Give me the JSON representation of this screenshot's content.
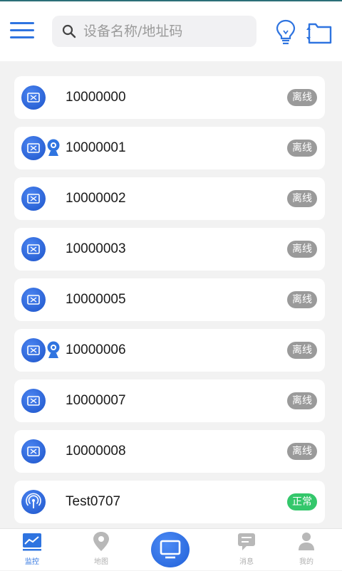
{
  "search": {
    "placeholder": "设备名称/地址码"
  },
  "devices": [
    {
      "id": "10000000",
      "status": "离线",
      "state": "offline",
      "icon": "tv-icon",
      "camera": false
    },
    {
      "id": "10000001",
      "status": "离线",
      "state": "offline",
      "icon": "tv-icon",
      "camera": true
    },
    {
      "id": "10000002",
      "status": "离线",
      "state": "offline",
      "icon": "tv-icon",
      "camera": false
    },
    {
      "id": "10000003",
      "status": "离线",
      "state": "offline",
      "icon": "tv-icon",
      "camera": false
    },
    {
      "id": "10000005",
      "status": "离线",
      "state": "offline",
      "icon": "tv-icon",
      "camera": false
    },
    {
      "id": "10000006",
      "status": "离线",
      "state": "offline",
      "icon": "tv-icon",
      "camera": true
    },
    {
      "id": "10000007",
      "status": "离线",
      "state": "offline",
      "icon": "tv-icon",
      "camera": false
    },
    {
      "id": "10000008",
      "status": "离线",
      "state": "offline",
      "icon": "tv-icon",
      "camera": false
    },
    {
      "id": "Test0707",
      "status": "正常",
      "state": "online",
      "icon": "signal-tower-icon",
      "camera": false
    }
  ],
  "tabs": {
    "monitor": "监控",
    "map": "地图",
    "messages": "消息",
    "mine": "我的"
  },
  "colors": {
    "accent": "#2f74e0",
    "offline": "#9a9a9a",
    "online": "#34c76b"
  }
}
